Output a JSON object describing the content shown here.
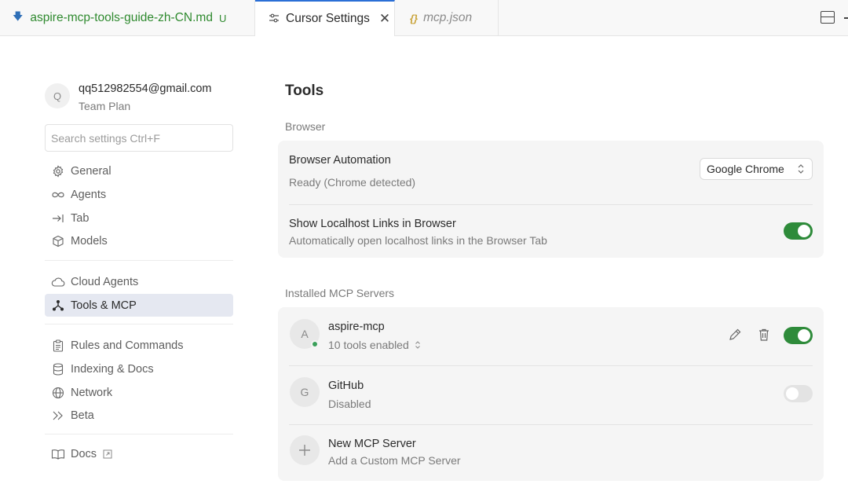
{
  "tabs": [
    {
      "label": "aspire-mcp-tools-guide-zh-CN.md",
      "badge": "U",
      "icon": "download-arrow-icon"
    },
    {
      "label": "Cursor Settings",
      "icon": "settings-sliders-icon",
      "active": true
    },
    {
      "label": "mcp.json",
      "icon": "json-braces-icon"
    }
  ],
  "account": {
    "avatar_letter": "Q",
    "email": "qq512982554@gmail.com",
    "plan": "Team Plan"
  },
  "search": {
    "placeholder": "Search settings Ctrl+F"
  },
  "sidebar": {
    "items": [
      {
        "label": "General",
        "icon": "gear-icon"
      },
      {
        "label": "Agents",
        "icon": "infinity-icon"
      },
      {
        "label": "Tab",
        "icon": "arrow-right-bar-icon"
      },
      {
        "label": "Models",
        "icon": "cube-icon"
      },
      {
        "label": "Cloud Agents",
        "icon": "cloud-icon"
      },
      {
        "label": "Tools & MCP",
        "icon": "nodes-icon",
        "active": true
      },
      {
        "label": "Rules and Commands",
        "icon": "clipboard-icon"
      },
      {
        "label": "Indexing & Docs",
        "icon": "database-icon"
      },
      {
        "label": "Network",
        "icon": "globe-icon"
      },
      {
        "label": "Beta",
        "icon": "chevrons-right-icon"
      },
      {
        "label": "Docs",
        "icon": "book-icon"
      }
    ]
  },
  "main": {
    "title": "Tools",
    "browser_section": "Browser",
    "browser_automation": {
      "title": "Browser Automation",
      "status": "Ready (Chrome detected)",
      "selected": "Google Chrome"
    },
    "localhost_links": {
      "title": "Show Localhost Links in Browser",
      "description": "Automatically open localhost links in the Browser Tab",
      "enabled": true
    },
    "mcp_section": "Installed MCP Servers",
    "servers": [
      {
        "letter": "A",
        "name": "aspire-mcp",
        "status": "10 tools enabled",
        "enabled": true
      },
      {
        "letter": "G",
        "name": "GitHub",
        "status": "Disabled",
        "enabled": false
      }
    ],
    "new_server": {
      "title": "New MCP Server",
      "description": "Add a Custom MCP Server"
    }
  },
  "colors": {
    "accent_green": "#2e8b3a",
    "tab_accent": "#2b6fd6",
    "status_dot": "#3aa05a"
  }
}
